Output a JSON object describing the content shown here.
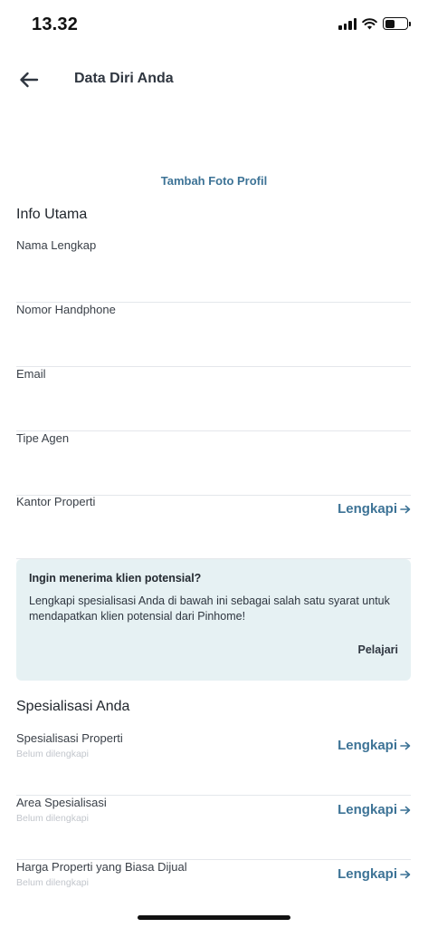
{
  "status_bar": {
    "time": "13.32",
    "battery_level": 0.45
  },
  "header": {
    "title": "Data Diri Anda",
    "back_icon": "arrow-left-icon"
  },
  "profile": {
    "add_photo_label": "Tambah Foto Profil",
    "avatar_icon": "person-silhouette-icon"
  },
  "main_info": {
    "title": "Info Utama",
    "fields": [
      {
        "label": "Nama Lengkap"
      },
      {
        "label": "Nomor Handphone"
      },
      {
        "label": "Email"
      },
      {
        "label": "Tipe Agen"
      },
      {
        "label": "Kantor Properti",
        "action": "Lengkapi"
      }
    ]
  },
  "promo_card": {
    "heading": "Ingin menerima klien potensial?",
    "body": "Lengkapi spesialisasi Anda di bawah ini sebagai salah satu syarat untuk mendapatkan klien potensial dari Pinhome!",
    "link": "Pelajari"
  },
  "specialization": {
    "title": "Spesialisasi Anda",
    "fields": [
      {
        "label": "Spesialisasi Properti",
        "status": "Belum dilengkapi",
        "action": "Lengkapi"
      },
      {
        "label": "Area Spesialisasi",
        "status": "Belum dilengkapi",
        "action": "Lengkapi"
      },
      {
        "label": "Harga Properti yang Biasa Dijual",
        "status": "Belum dilengkapi",
        "action": "Lengkapi"
      }
    ]
  },
  "colors": {
    "accent": "#3d7396",
    "card_bg": "#e6f1f3",
    "divider": "#e4e7eb"
  }
}
